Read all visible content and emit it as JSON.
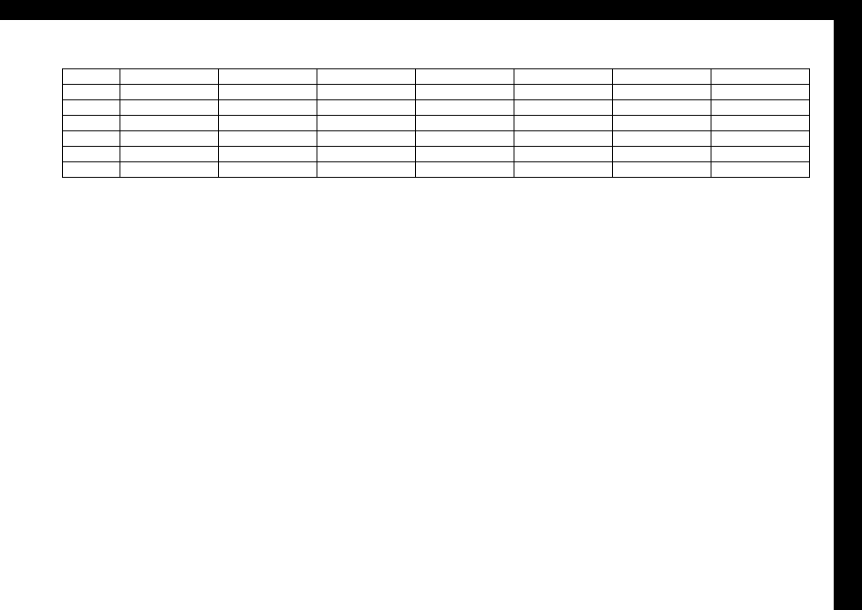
{
  "table": {
    "columns": 8,
    "rows": [
      [
        "",
        "",
        "",
        "",
        "",
        "",
        "",
        ""
      ],
      [
        "",
        "",
        "",
        "",
        "",
        "",
        "",
        ""
      ],
      [
        "",
        "",
        "",
        "",
        "",
        "",
        "",
        ""
      ],
      [
        "",
        "",
        "",
        "",
        "",
        "",
        "",
        ""
      ],
      [
        "",
        "",
        "",
        "",
        "",
        "",
        "",
        ""
      ],
      [
        "",
        "",
        "",
        "",
        "",
        "",
        "",
        ""
      ],
      [
        "",
        "",
        "",
        "",
        "",
        "",
        "",
        ""
      ]
    ],
    "accent_row_index": 3
  }
}
